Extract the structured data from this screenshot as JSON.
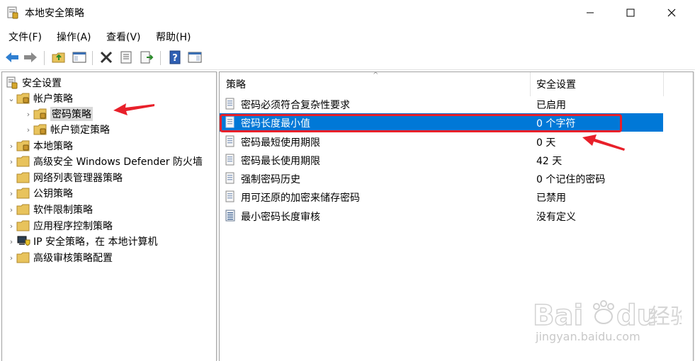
{
  "window": {
    "title": "本地安全策略",
    "controls": [
      "minimize",
      "maximize",
      "close"
    ]
  },
  "menu": {
    "items": [
      "文件(F)",
      "操作(A)",
      "查看(V)",
      "帮助(H)"
    ]
  },
  "toolbar": {
    "icons": [
      "back-icon",
      "forward-icon",
      "up-folder-icon",
      "show-hide-tree-icon",
      "delete-icon",
      "properties-icon",
      "export-list-icon",
      "help-icon",
      "action-pane-icon"
    ]
  },
  "tree": {
    "root": "安全设置",
    "items": [
      {
        "label": "帐户策略",
        "expanded": true,
        "level": 1
      },
      {
        "label": "密码策略",
        "level": 2,
        "selected": true
      },
      {
        "label": "帐户锁定策略",
        "level": 2
      },
      {
        "label": "本地策略",
        "level": 1
      },
      {
        "label": "高级安全 Windows Defender 防火墙",
        "level": 1
      },
      {
        "label": "网络列表管理器策略",
        "level": 1
      },
      {
        "label": "公钥策略",
        "level": 1
      },
      {
        "label": "软件限制策略",
        "level": 1
      },
      {
        "label": "应用程序控制策略",
        "level": 1
      },
      {
        "label": "IP 安全策略，在 本地计算机",
        "level": 1
      },
      {
        "label": "高级审核策略配置",
        "level": 1
      }
    ]
  },
  "list": {
    "columns": [
      "策略",
      "安全设置"
    ],
    "rows": [
      {
        "policy": "密码必须符合复杂性要求",
        "setting": "已启用"
      },
      {
        "policy": "密码长度最小值",
        "setting": "0 个字符",
        "selected": true
      },
      {
        "policy": "密码最短使用期限",
        "setting": "0 天"
      },
      {
        "policy": "密码最长使用期限",
        "setting": "42 天"
      },
      {
        "policy": "强制密码历史",
        "setting": "0 个记住的密码"
      },
      {
        "policy": "用可还原的加密来储存密码",
        "setting": "已禁用"
      },
      {
        "policy": "最小密码长度审核",
        "setting": "没有定义"
      }
    ]
  },
  "watermark": {
    "brand": "Bai du 经验",
    "url": "jingyan.baidu.com"
  },
  "colors": {
    "selection": "#0078d7",
    "annotation": "#e8202a",
    "tree_selection": "#d9d9d9"
  }
}
